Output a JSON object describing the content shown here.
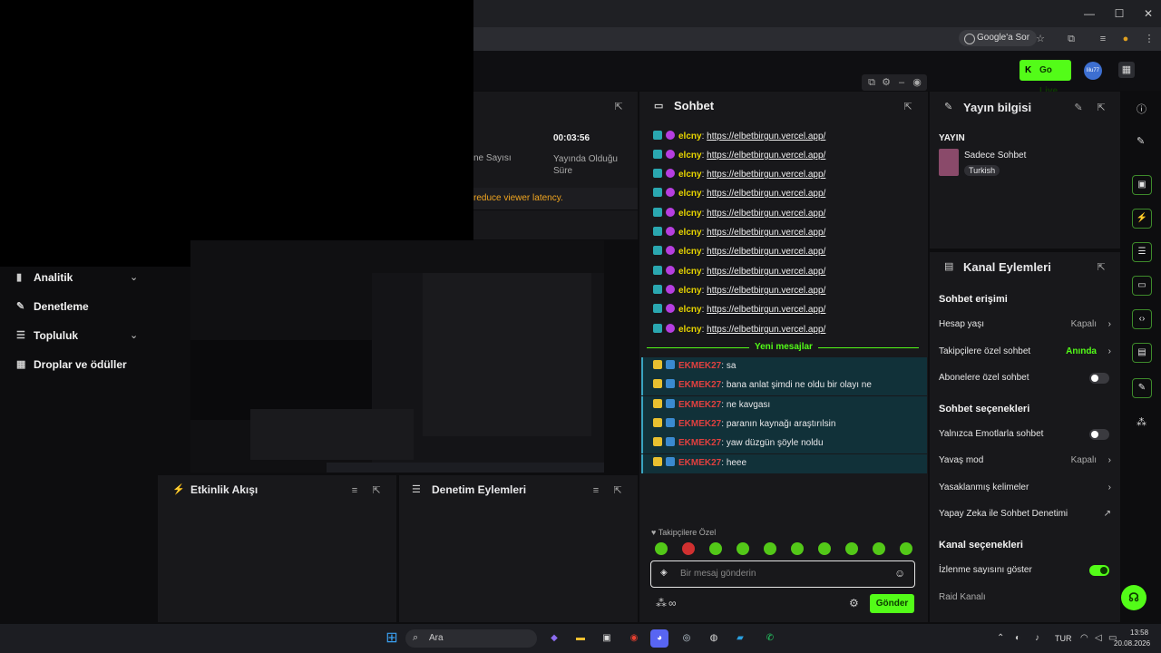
{
  "browser": {
    "window_controls": [
      "—",
      "☐",
      "✕"
    ],
    "google_sor": "Google'a Sor"
  },
  "header": {
    "go_live": "Go Live",
    "avatar_text": "lilu77"
  },
  "stats": {
    "duration_value": "00:03:56",
    "duration_label": "Yayında Olduğu Süre",
    "viewers_label_fragment": "ne Sayısı",
    "latency_notice": "reduce viewer latency."
  },
  "sidebar": {
    "items": [
      {
        "label": "Analitik",
        "icon": "chart-icon",
        "chevron": true
      },
      {
        "label": "Denetleme",
        "icon": "wrench-icon",
        "chevron": false
      },
      {
        "label": "Topluluk",
        "icon": "users-icon",
        "chevron": true
      },
      {
        "label": "Droplar ve ödüller",
        "icon": "gift-icon",
        "chevron": false
      }
    ]
  },
  "chat": {
    "title": "Sohbet",
    "link_messages": [
      {
        "user": "elcny",
        "text": "https://elbetbirgun.vercel.app/"
      },
      {
        "user": "elcny",
        "text": "https://elbetbirgun.vercel.app/"
      },
      {
        "user": "elcny",
        "text": "https://elbetbirgun.vercel.app/"
      },
      {
        "user": "elcny",
        "text": "https://elbetbirgun.vercel.app/"
      },
      {
        "user": "elcny",
        "text": "https://elbetbirgun.vercel.app/"
      },
      {
        "user": "elcny",
        "text": "https://elbetbirgun.vercel.app/"
      },
      {
        "user": "elcny",
        "text": "https://elbetbirgun.vercel.app/"
      },
      {
        "user": "elcny",
        "text": "https://elbetbirgun.vercel.app/"
      },
      {
        "user": "elcny",
        "text": "https://elbetbirgun.vercel.app/"
      },
      {
        "user": "elcny",
        "text": "https://elbetbirgun.vercel.app/"
      },
      {
        "user": "elcny",
        "text": "https://elbetbirgun.vercel.app/"
      }
    ],
    "new_messages_label": "Yeni mesajlar",
    "new_messages": [
      {
        "user": "EKMEK27",
        "text": "sa"
      },
      {
        "user": "EKMEK27",
        "text": "bana anlat şimdi ne oldu bir olayı ne"
      },
      {
        "user": "EKMEK27",
        "text": "ne kavgası"
      },
      {
        "user": "EKMEK27",
        "text": "paranın kaynağı araştırılsin"
      },
      {
        "user": "EKMEK27",
        "text": "yaw düzgün şöyle noldu"
      },
      {
        "user": "EKMEK27",
        "text": "heee"
      }
    ],
    "followers_only": "Takipçilere Özel",
    "input_placeholder": "Bir mesaj gönderin",
    "send_label": "Gönder"
  },
  "stream_info": {
    "title": "Yayın bilgisi",
    "section": "YAYIN",
    "stream_title": "Sadece Sohbet",
    "language": "Turkish"
  },
  "channel_actions": {
    "title": "Kanal Eylemleri",
    "chat_access_heading": "Sohbet erişimi",
    "account_age": {
      "label": "Hesap yaşı",
      "value": "Kapalı"
    },
    "followers_chat": {
      "label": "Takipçilere özel sohbet",
      "value": "Anında"
    },
    "subscribers_chat": {
      "label": "Abonelere özel sohbet"
    },
    "chat_options_heading": "Sohbet seçenekleri",
    "emote_only": {
      "label": "Yalnızca Emotlarla sohbet"
    },
    "slow_mode": {
      "label": "Yavaş mod",
      "value": "Kapalı"
    },
    "banned_words": {
      "label": "Yasaklanmış kelimeler"
    },
    "ai_moderation": {
      "label": "Yapay Zeka ile Sohbet Denetimi"
    },
    "channel_options_heading": "Kanal seçenekleri",
    "show_viewers": {
      "label": "İzlenme sayısını göster",
      "on": true
    },
    "raid_channel": {
      "label": "Raid Kanalı"
    }
  },
  "bottom_panels": {
    "activity_feed": "Etkinlik Akışı",
    "mod_actions": "Denetim Eylemleri"
  },
  "taskbar": {
    "search": "Ara",
    "lang": "TUR",
    "time": "13:58",
    "date": "20.08.2026"
  },
  "colors": {
    "accent": "#53fc18",
    "panel": "#18181b",
    "user_elcny": "#e8d500",
    "user_ekmek": "#e0403f"
  }
}
